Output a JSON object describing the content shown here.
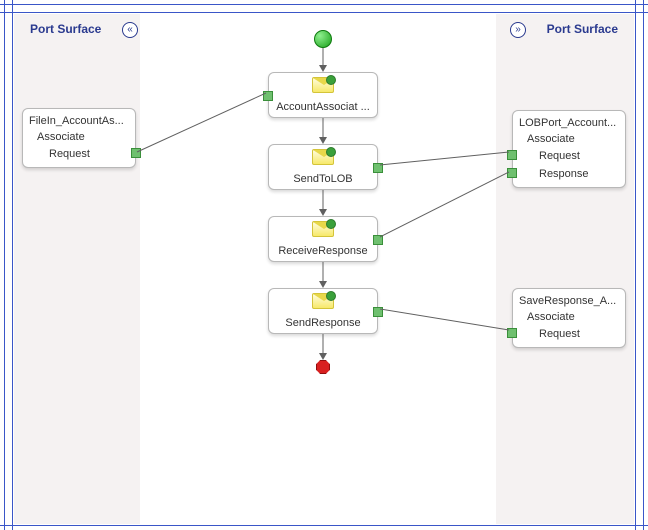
{
  "surfaces": {
    "left_label": "Port Surface",
    "right_label": "Port Surface"
  },
  "ports_left": {
    "file_in": {
      "title": "FileIn_AccountAs...",
      "operation": "Associate",
      "msg_request": "Request"
    }
  },
  "ports_right": {
    "lob": {
      "title": "LOBPort_Account...",
      "operation": "Associate",
      "msg_request": "Request",
      "msg_response": "Response"
    },
    "save": {
      "title": "SaveResponse_A...",
      "operation": "Associate",
      "msg_request": "Request"
    }
  },
  "shapes": {
    "acct_associate": "AccountAssociat ...",
    "send_lob": "SendToLOB",
    "recv_resp": "ReceiveResponse",
    "send_resp": "SendResponse"
  },
  "colors": {
    "border": "#3a56c8"
  }
}
